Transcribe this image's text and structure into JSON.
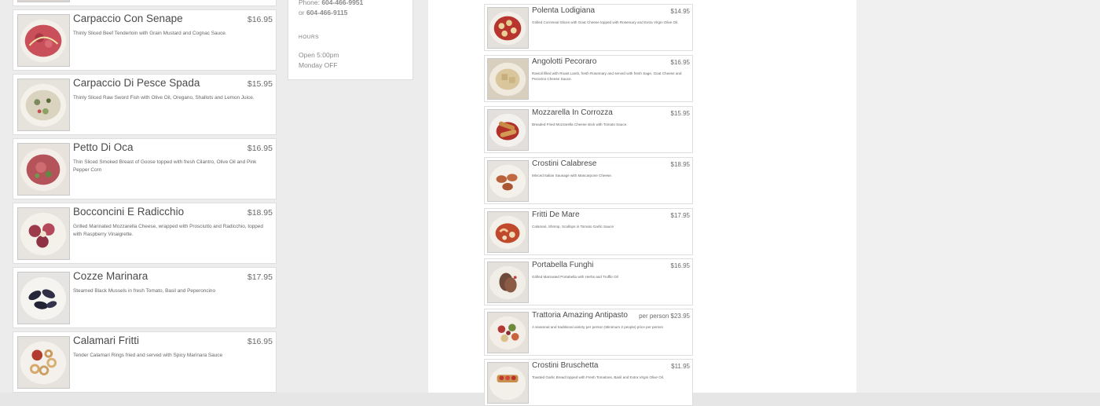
{
  "left_menu": [
    {
      "name": "Carpaccio Con Senape",
      "price": "$16.95",
      "desc": "Thinly Sliced Beef Tenderloin with Grain Mustard and Cognac Sauce.",
      "image_icon": "beef-carpaccio-photo"
    },
    {
      "name": "Carpaccio Di Pesce Spada",
      "price": "$15.95",
      "desc": "Thinly Sliced Raw Sword Fish with Olive Oil, Oregano, Shallots and Lemon Juice.",
      "image_icon": "swordfish-carpaccio-photo"
    },
    {
      "name": "Petto Di Oca",
      "price": "$16.95",
      "desc": "Thin Sliced Smoked Breast of Goose topped with fresh Cilantro, Olive Oil and Pink Pepper Corn",
      "image_icon": "goose-breast-photo"
    },
    {
      "name": "Bocconcini E Radicchio",
      "price": "$18.95",
      "desc": "Grilled Marinated Mozzarella Cheese, wrapped with Prosciutto and Radicchio, topped with Raspberry Vinaigrette.",
      "image_icon": "bocconcini-photo"
    },
    {
      "name": "Cozze Marinara",
      "price": "$17.95",
      "desc": "Steamed Black Mussels in fresh Tomato, Basil and Peperoncino",
      "image_icon": "mussels-photo"
    },
    {
      "name": "Calamari Fritti",
      "price": "$16.95",
      "desc": "Tender Calamari Rings fried and served with Spicy Marinara Sauce",
      "image_icon": "calamari-photo"
    }
  ],
  "right_menu": [
    {
      "name": "Polenta Lodigiana",
      "price": "$14.95",
      "desc": "Grilled Cornmeal Slices with Goat Cheese topped with Rosemary and Extra Virgin Olive Oil.",
      "image_icon": "polenta-photo"
    },
    {
      "name": "Angolotti Pecoraro",
      "price": "$16.95",
      "desc": "Ravioli filled with Roast Lamb, fresh Rosemary and served with fresh Sage, Goat Cheese and Pecorino Cheese Sauce.",
      "image_icon": "ravioli-photo"
    },
    {
      "name": "Mozzarella In Corrozza",
      "price": "$15.95",
      "desc": "Breaded Fried Mozzarella Cheese stick with Tomato Sauce.",
      "image_icon": "fried-mozzarella-photo"
    },
    {
      "name": "Crostini Calabrese",
      "price": "$18.95",
      "desc": "Minced Italian Sausage with Mascarpone Cheese.",
      "image_icon": "crostini-calabrese-photo"
    },
    {
      "name": "Fritti De Mare",
      "price": "$17.95",
      "desc": "Calamari, Shrimp, Scallops in Tomato Garlic Sauce",
      "image_icon": "seafood-photo"
    },
    {
      "name": "Portabella Funghi",
      "price": "$16.95",
      "desc": "Grilled Marinated Portabella with Herbs and Truffle Oil",
      "image_icon": "portabella-photo"
    },
    {
      "name": "Trattoria Amazing Antipasto",
      "price": "per person $23.95",
      "desc": "A seasonal and traditional variety per person (Minimum 2 people) price per person",
      "image_icon": "antipasto-photo"
    },
    {
      "name": "Crostini Bruschetta",
      "price": "$11.95",
      "desc": "Toasted Garlic Bread topped with Fresh Tomatoes, Basil and Extra Virgin Olive Oil.",
      "image_icon": "bruschetta-photo"
    }
  ],
  "info": {
    "phone_label": "Phone:",
    "phone": "604-466-9951",
    "alt_label": "or",
    "alt_phone": "604-466-9115",
    "hours_heading": "HOURS",
    "open_time": "Open 5:00pm",
    "closed_day": "Monday OFF"
  },
  "colors": {
    "page_bg": "#e6e6e6",
    "card_bg": "#ffffff",
    "text": "#4a4a4a",
    "price": "#6a6a6a"
  }
}
